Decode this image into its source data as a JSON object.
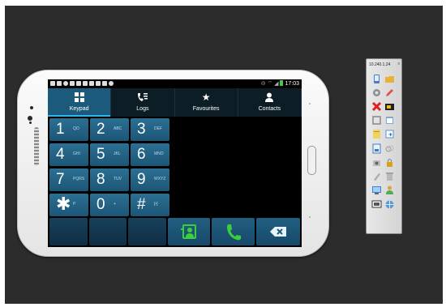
{
  "status_bar": {
    "time": "17:03"
  },
  "tabs": [
    {
      "label": "Keypad",
      "icon": "keypad-icon",
      "active": true
    },
    {
      "label": "Logs",
      "icon": "logs-icon",
      "active": false
    },
    {
      "label": "Favourites",
      "icon": "star-icon",
      "active": false
    },
    {
      "label": "Contacts",
      "icon": "contact-icon",
      "active": false
    }
  ],
  "keys": [
    {
      "digit": "1",
      "letters": "QO"
    },
    {
      "digit": "2",
      "letters": "ABC"
    },
    {
      "digit": "3",
      "letters": "DEF"
    },
    {
      "digit": "4",
      "letters": "GHI"
    },
    {
      "digit": "5",
      "letters": "JKL"
    },
    {
      "digit": "6",
      "letters": "MNO"
    },
    {
      "digit": "7",
      "letters": "PQRS"
    },
    {
      "digit": "8",
      "letters": "TUV"
    },
    {
      "digit": "9",
      "letters": "WXYZ"
    },
    {
      "digit": "✱",
      "letters": "P"
    },
    {
      "digit": "0",
      "letters": "+"
    },
    {
      "digit": "#",
      "letters": "[•]"
    }
  ],
  "actions": [
    {
      "name": "add-contact-icon"
    },
    {
      "name": "call-icon"
    },
    {
      "name": "backspace-icon"
    }
  ],
  "toolbar": {
    "ip": "10.240.1.24",
    "close": "x"
  },
  "colors": {
    "accent": "#30b5ea",
    "key_bg": "#1f5f82",
    "call_green": "#3ccf3c"
  }
}
